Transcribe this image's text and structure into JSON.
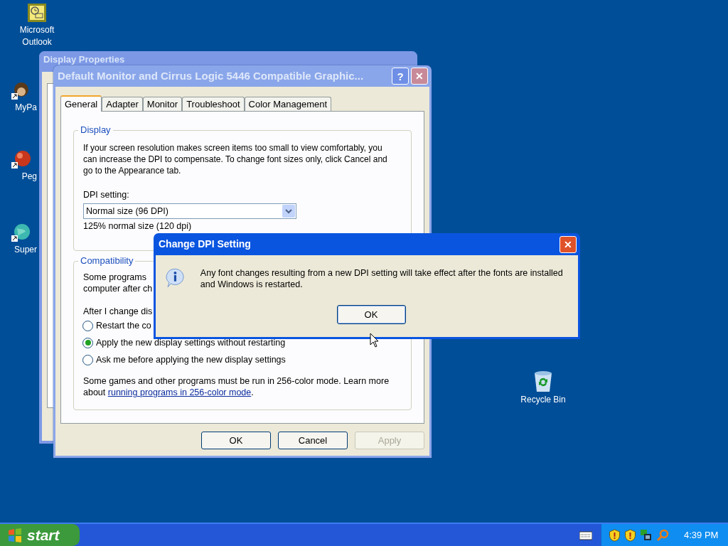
{
  "desktop_icons": [
    {
      "label": "Microsoft Outlook",
      "kind": "outlook"
    },
    {
      "label": "MyPa",
      "kind": "mypal"
    },
    {
      "label": "Peg",
      "kind": "peg"
    },
    {
      "label": "Super",
      "kind": "globe"
    },
    {
      "label": "Recycle Bin",
      "kind": "recycle"
    }
  ],
  "back_window": {
    "title": "Display Properties"
  },
  "window": {
    "title": "Default Monitor and Cirrus Logic 5446 Compatible Graphic...",
    "help": "?",
    "close": "✕",
    "tabs": [
      {
        "label": "General",
        "selected": true
      },
      {
        "label": "Adapter",
        "selected": false
      },
      {
        "label": "Monitor",
        "selected": false
      },
      {
        "label": "Troubleshoot",
        "selected": false
      },
      {
        "label": "Color Management",
        "selected": false
      }
    ],
    "display_group": {
      "title": "Display",
      "description": "If your screen resolution makes screen items too small to view comfortably, you can increase the DPI to compensate.  To change font sizes only, click Cancel and go to the Appearance tab.",
      "dpi_label": "DPI setting:",
      "dpi_value": "Normal size (96 DPI)",
      "dpi_note": "125% normal size (120 dpi)"
    },
    "compat_group": {
      "title": "Compatibility",
      "line_1": "Some programs",
      "line_2": "computer after ch",
      "after_label": "After I change dis",
      "options": [
        {
          "label": "Restart the co",
          "selected": false
        },
        {
          "label": "Apply the new display settings without restarting",
          "selected": true
        },
        {
          "label": "Ask me before applying the new display settings",
          "selected": false
        }
      ],
      "note": "Some games and other programs must be run in 256-color mode.  Learn more about",
      "link": "running programs in 256-color mode",
      "after_link": "."
    },
    "buttons": [
      {
        "label": "OK",
        "disabled": false
      },
      {
        "label": "Cancel",
        "disabled": false
      },
      {
        "label": "Apply",
        "disabled": true
      }
    ]
  },
  "dialog": {
    "title": "Change DPI Setting",
    "close": "✕",
    "message": "Any font changes resulting from a new DPI setting will take effect after the fonts are installed and Windows is restarted.",
    "button": "OK"
  },
  "taskbar": {
    "start": "start",
    "clock": "4:39 PM"
  }
}
